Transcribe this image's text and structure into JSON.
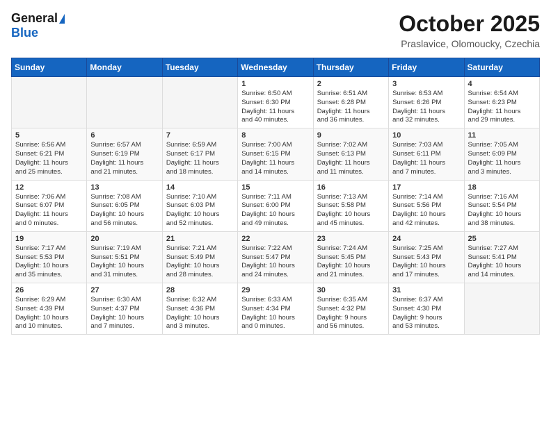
{
  "header": {
    "logo_general": "General",
    "logo_blue": "Blue",
    "month_title": "October 2025",
    "location": "Praslavice, Olomoucky, Czechia"
  },
  "weekdays": [
    "Sunday",
    "Monday",
    "Tuesday",
    "Wednesday",
    "Thursday",
    "Friday",
    "Saturday"
  ],
  "weeks": [
    [
      {
        "day": "",
        "content": ""
      },
      {
        "day": "",
        "content": ""
      },
      {
        "day": "",
        "content": ""
      },
      {
        "day": "1",
        "content": "Sunrise: 6:50 AM\nSunset: 6:30 PM\nDaylight: 11 hours\nand 40 minutes."
      },
      {
        "day": "2",
        "content": "Sunrise: 6:51 AM\nSunset: 6:28 PM\nDaylight: 11 hours\nand 36 minutes."
      },
      {
        "day": "3",
        "content": "Sunrise: 6:53 AM\nSunset: 6:26 PM\nDaylight: 11 hours\nand 32 minutes."
      },
      {
        "day": "4",
        "content": "Sunrise: 6:54 AM\nSunset: 6:23 PM\nDaylight: 11 hours\nand 29 minutes."
      }
    ],
    [
      {
        "day": "5",
        "content": "Sunrise: 6:56 AM\nSunset: 6:21 PM\nDaylight: 11 hours\nand 25 minutes."
      },
      {
        "day": "6",
        "content": "Sunrise: 6:57 AM\nSunset: 6:19 PM\nDaylight: 11 hours\nand 21 minutes."
      },
      {
        "day": "7",
        "content": "Sunrise: 6:59 AM\nSunset: 6:17 PM\nDaylight: 11 hours\nand 18 minutes."
      },
      {
        "day": "8",
        "content": "Sunrise: 7:00 AM\nSunset: 6:15 PM\nDaylight: 11 hours\nand 14 minutes."
      },
      {
        "day": "9",
        "content": "Sunrise: 7:02 AM\nSunset: 6:13 PM\nDaylight: 11 hours\nand 11 minutes."
      },
      {
        "day": "10",
        "content": "Sunrise: 7:03 AM\nSunset: 6:11 PM\nDaylight: 11 hours\nand 7 minutes."
      },
      {
        "day": "11",
        "content": "Sunrise: 7:05 AM\nSunset: 6:09 PM\nDaylight: 11 hours\nand 3 minutes."
      }
    ],
    [
      {
        "day": "12",
        "content": "Sunrise: 7:06 AM\nSunset: 6:07 PM\nDaylight: 11 hours\nand 0 minutes."
      },
      {
        "day": "13",
        "content": "Sunrise: 7:08 AM\nSunset: 6:05 PM\nDaylight: 10 hours\nand 56 minutes."
      },
      {
        "day": "14",
        "content": "Sunrise: 7:10 AM\nSunset: 6:03 PM\nDaylight: 10 hours\nand 52 minutes."
      },
      {
        "day": "15",
        "content": "Sunrise: 7:11 AM\nSunset: 6:00 PM\nDaylight: 10 hours\nand 49 minutes."
      },
      {
        "day": "16",
        "content": "Sunrise: 7:13 AM\nSunset: 5:58 PM\nDaylight: 10 hours\nand 45 minutes."
      },
      {
        "day": "17",
        "content": "Sunrise: 7:14 AM\nSunset: 5:56 PM\nDaylight: 10 hours\nand 42 minutes."
      },
      {
        "day": "18",
        "content": "Sunrise: 7:16 AM\nSunset: 5:54 PM\nDaylight: 10 hours\nand 38 minutes."
      }
    ],
    [
      {
        "day": "19",
        "content": "Sunrise: 7:17 AM\nSunset: 5:53 PM\nDaylight: 10 hours\nand 35 minutes."
      },
      {
        "day": "20",
        "content": "Sunrise: 7:19 AM\nSunset: 5:51 PM\nDaylight: 10 hours\nand 31 minutes."
      },
      {
        "day": "21",
        "content": "Sunrise: 7:21 AM\nSunset: 5:49 PM\nDaylight: 10 hours\nand 28 minutes."
      },
      {
        "day": "22",
        "content": "Sunrise: 7:22 AM\nSunset: 5:47 PM\nDaylight: 10 hours\nand 24 minutes."
      },
      {
        "day": "23",
        "content": "Sunrise: 7:24 AM\nSunset: 5:45 PM\nDaylight: 10 hours\nand 21 minutes."
      },
      {
        "day": "24",
        "content": "Sunrise: 7:25 AM\nSunset: 5:43 PM\nDaylight: 10 hours\nand 17 minutes."
      },
      {
        "day": "25",
        "content": "Sunrise: 7:27 AM\nSunset: 5:41 PM\nDaylight: 10 hours\nand 14 minutes."
      }
    ],
    [
      {
        "day": "26",
        "content": "Sunrise: 6:29 AM\nSunset: 4:39 PM\nDaylight: 10 hours\nand 10 minutes."
      },
      {
        "day": "27",
        "content": "Sunrise: 6:30 AM\nSunset: 4:37 PM\nDaylight: 10 hours\nand 7 minutes."
      },
      {
        "day": "28",
        "content": "Sunrise: 6:32 AM\nSunset: 4:36 PM\nDaylight: 10 hours\nand 3 minutes."
      },
      {
        "day": "29",
        "content": "Sunrise: 6:33 AM\nSunset: 4:34 PM\nDaylight: 10 hours\nand 0 minutes."
      },
      {
        "day": "30",
        "content": "Sunrise: 6:35 AM\nSunset: 4:32 PM\nDaylight: 9 hours\nand 56 minutes."
      },
      {
        "day": "31",
        "content": "Sunrise: 6:37 AM\nSunset: 4:30 PM\nDaylight: 9 hours\nand 53 minutes."
      },
      {
        "day": "",
        "content": ""
      }
    ]
  ]
}
